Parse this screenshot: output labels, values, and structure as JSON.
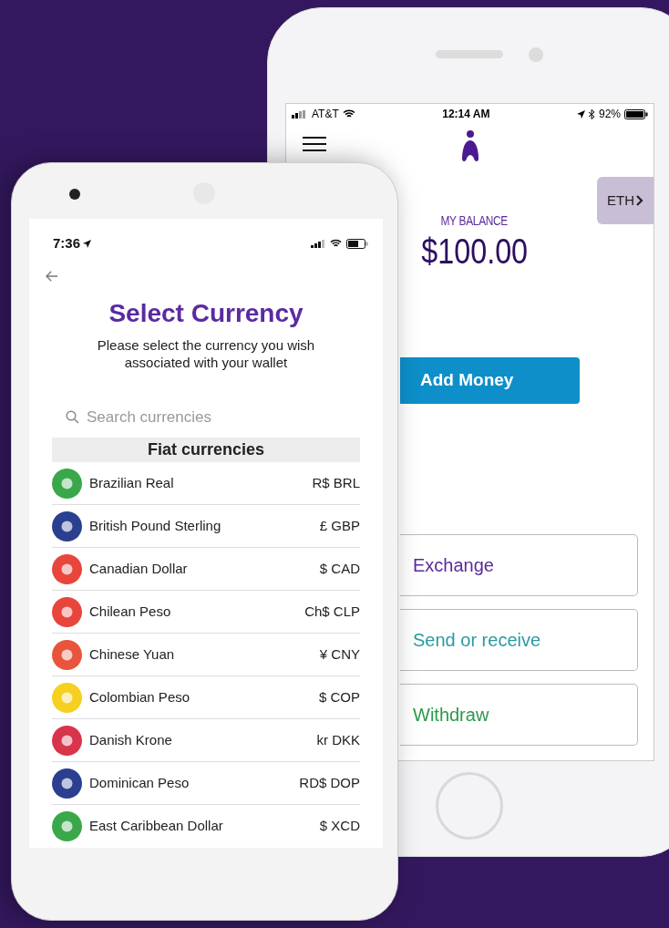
{
  "back_phone": {
    "status_bar": {
      "carrier": "AT&T",
      "time": "12:14 AM",
      "battery": "92%"
    },
    "balance_label": "MY BALANCE",
    "balance": "$100.00",
    "currency_tab": "ETH",
    "add_money": "Add Money",
    "actions": [
      {
        "label": "Exchange",
        "color": "#5b2a9a"
      },
      {
        "label": "Send or receive",
        "color": "#2a9aa0"
      },
      {
        "label": "Withdraw",
        "color": "#2a9a4a"
      }
    ]
  },
  "front_phone": {
    "status_bar": {
      "time": "7:36"
    },
    "title": "Select Currency",
    "subtitle": "Please select the currency you wish associated with your wallet",
    "search": {
      "placeholder": "Search currencies"
    },
    "section": "Fiat currencies",
    "currencies": [
      {
        "name": "Brazilian Real",
        "code": "R$ BRL",
        "color": "#3aa84a"
      },
      {
        "name": "British Pound Sterling",
        "code": "£ GBP",
        "color": "#2a3f8f"
      },
      {
        "name": "Canadian Dollar",
        "code": "$ CAD",
        "color": "#e8453c"
      },
      {
        "name": "Chilean Peso",
        "code": "Ch$ CLP",
        "color": "#e8453c"
      },
      {
        "name": "Chinese Yuan",
        "code": "¥ CNY",
        "color": "#e8553c"
      },
      {
        "name": "Colombian Peso",
        "code": "$ COP",
        "color": "#f5d020"
      },
      {
        "name": "Danish Krone",
        "code": "kr DKK",
        "color": "#d8344c"
      },
      {
        "name": "Dominican Peso",
        "code": "RD$ DOP",
        "color": "#2a3f8f"
      },
      {
        "name": "East Caribbean Dollar",
        "code": "$ XCD",
        "color": "#3aa84a"
      }
    ]
  }
}
